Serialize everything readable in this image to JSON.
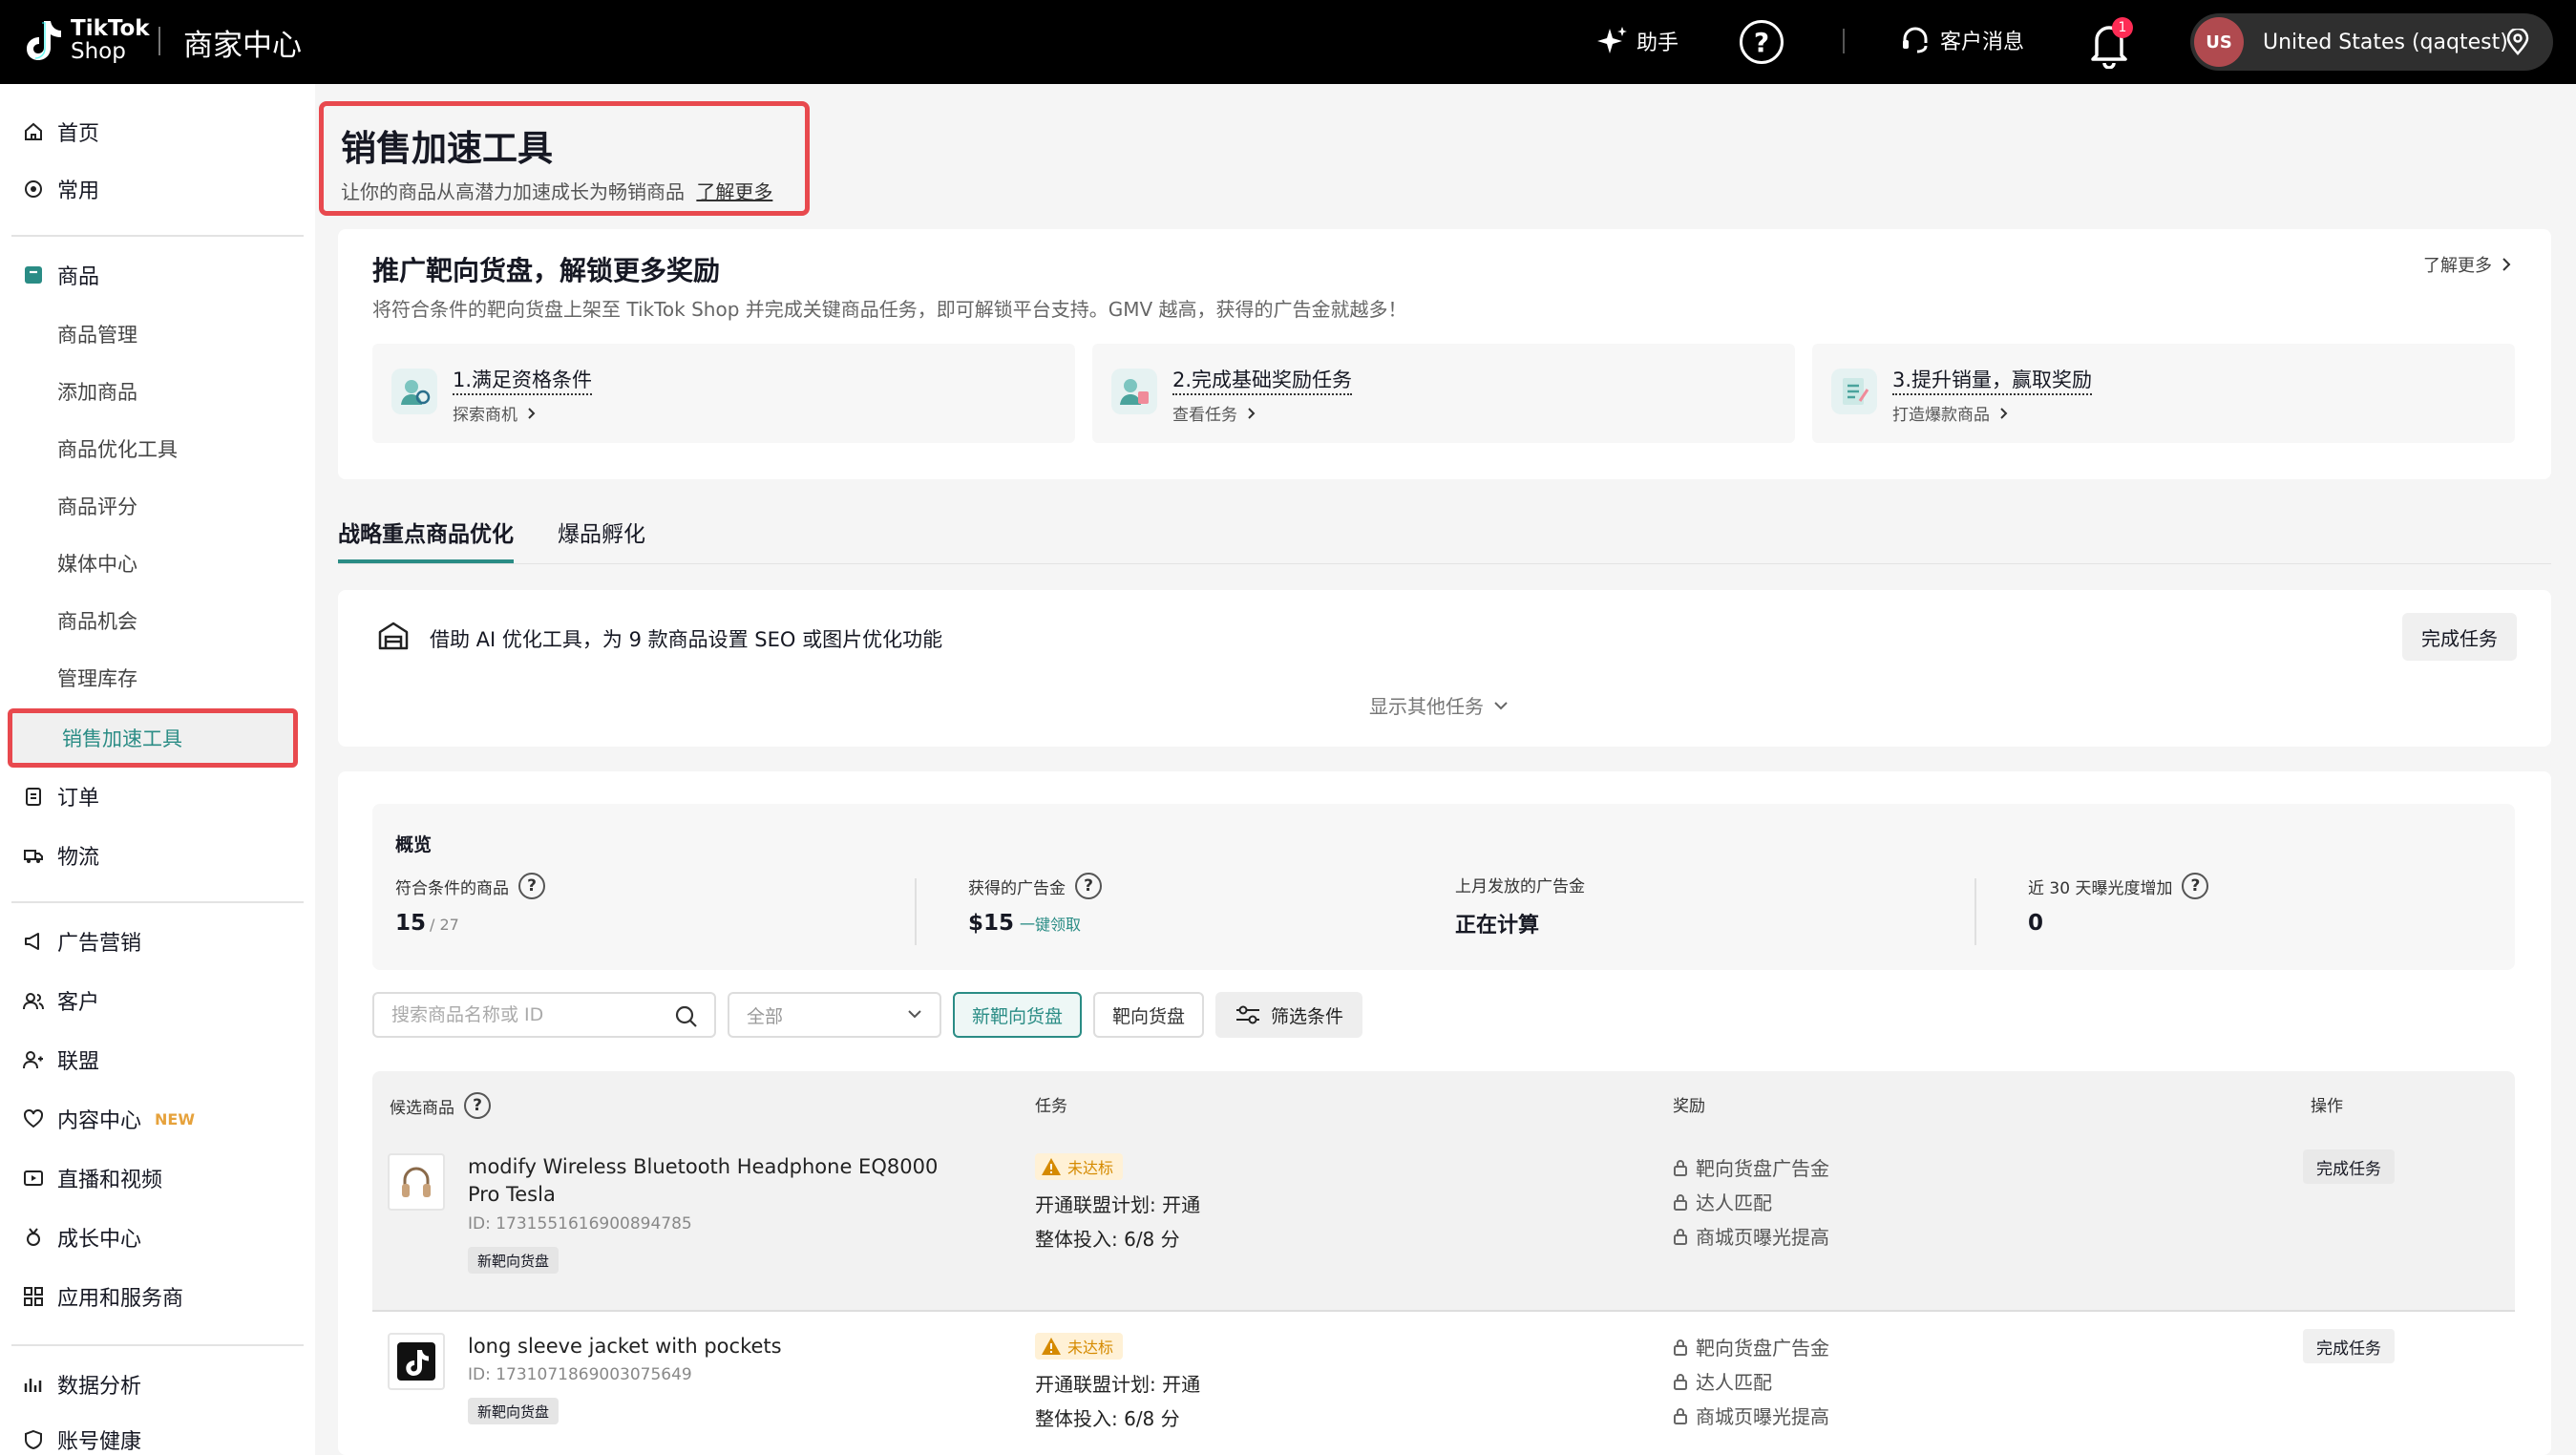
{
  "topbar": {
    "logo_line1": "TikTok",
    "logo_line2": "Shop",
    "title": "商家中心",
    "assistant": "助手",
    "help": "?",
    "messages": "客户消息",
    "notification_count": "1",
    "region_avatar": "US",
    "region": "United States (qaqtest)"
  },
  "sidebar": {
    "home": "首页",
    "frequent": "常用",
    "products": "商品",
    "product_subitems": [
      "商品管理",
      "添加商品",
      "商品优化工具",
      "商品评分",
      "媒体中心",
      "商品机会",
      "管理库存"
    ],
    "active_item": "销售加速工具",
    "orders": "订单",
    "logistics": "物流",
    "ads": "广告营销",
    "customers": "客户",
    "affiliate": "联盟",
    "content": "内容中心",
    "content_tag": "NEW",
    "live": "直播和视频",
    "growth": "成长中心",
    "apps": "应用和服务商",
    "analytics": "数据分析",
    "cut_off": "账号健康"
  },
  "page": {
    "title": "销售加速工具",
    "subtitle": "让你的商品从高潜力加速成长为畅销商品",
    "learn_more": "了解更多"
  },
  "promo": {
    "title": "推广靶向货盘，解锁更多奖励",
    "desc": "将符合条件的靶向货盘上架至 TikTok Shop 并完成关键商品任务，即可解锁平台支持。GMV 越高，获得的广告金就越多！",
    "learn_more": "了解更多",
    "steps": [
      {
        "title": "1.满足资格条件",
        "link": "探索商机"
      },
      {
        "title": "2.完成基础奖励任务",
        "link": "查看任务"
      },
      {
        "title": "3.提升销量，赢取奖励",
        "link": "打造爆款商品"
      }
    ]
  },
  "tabs": [
    "战略重点商品优化",
    "爆品孵化"
  ],
  "task": {
    "text": "借助 AI 优化工具，为 9 款商品设置 SEO 或图片优化功能",
    "button": "完成任务",
    "show_more": "显示其他任务"
  },
  "overview": {
    "title": "概览",
    "metrics": [
      {
        "label": "符合条件的商品",
        "value": "15",
        "sub": "/ 27"
      },
      {
        "label": "获得的广告金",
        "value": "$15",
        "link": "一键领取"
      },
      {
        "label": "上月发放的广告金",
        "value": "正在计算"
      },
      {
        "label": "近 30 天曝光度增加",
        "value": "0"
      }
    ]
  },
  "filters": {
    "search_placeholder": "搜索商品名称或 ID",
    "select_value": "全部",
    "chip_new": "新靶向货盘",
    "chip_target": "靶向货盘",
    "chip_filter": "筛选条件"
  },
  "table": {
    "headers": [
      "候选商品",
      "任务",
      "奖励",
      "操作"
    ],
    "rows": [
      {
        "name": "modify Wireless Bluetooth Headphone EQ8000 Pro Tesla",
        "id": "ID: 1731551616900894785",
        "tag": "新靶向货盘",
        "status": "未达标",
        "tasks": [
          "开通联盟计划: 开通",
          "整体投入: 6/8 分"
        ],
        "rewards": [
          "靶向货盘广告金",
          "达人匹配",
          "商城页曝光提高"
        ],
        "action": "完成任务"
      },
      {
        "name": "long sleeve jacket with pockets",
        "id": "ID: 1731071869003075649",
        "tag": "新靶向货盘",
        "status": "未达标",
        "tasks": [
          "开通联盟计划: 开通",
          "整体投入: 6/8 分"
        ],
        "rewards": [
          "靶向货盘广告金",
          "达人匹配",
          "商城页曝光提高"
        ],
        "action": "完成任务"
      }
    ]
  },
  "colors": {
    "accent": "#2a8c85",
    "highlight_border": "#e8494e",
    "warning": "#d58a00"
  }
}
